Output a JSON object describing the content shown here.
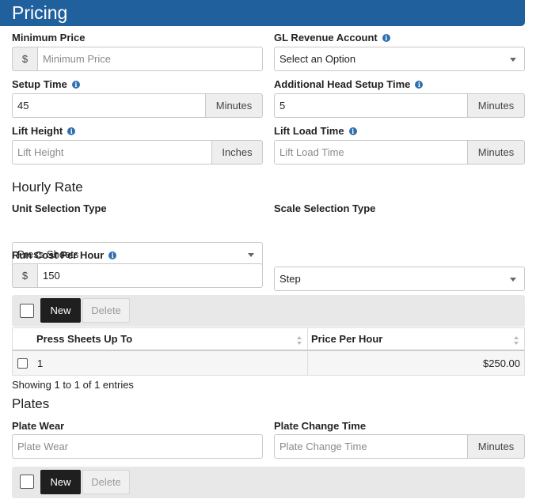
{
  "header": {
    "title": "Pricing"
  },
  "minimum_price": {
    "label": "Minimum Price",
    "prefix": "$",
    "placeholder": "Minimum Price",
    "value": ""
  },
  "gl_revenue_account": {
    "label": "GL Revenue Account",
    "selected": "Select an Option"
  },
  "setup_time": {
    "label": "Setup Time",
    "value": "45",
    "unit": "Minutes"
  },
  "additional_head_setup_time": {
    "label": "Additional Head Setup Time",
    "value": "5",
    "unit": "Minutes"
  },
  "lift_height": {
    "label": "Lift Height",
    "placeholder": "Lift Height",
    "unit": "Inches"
  },
  "lift_load_time": {
    "label": "Lift Load Time",
    "placeholder": "Lift Load Time",
    "unit": "Minutes"
  },
  "hourly_rate": {
    "title": "Hourly Rate",
    "unit_selection_type": {
      "label": "Unit Selection Type",
      "selected": "Press Sheets"
    },
    "scale_selection_type": {
      "label": "Scale Selection Type",
      "selected": "Step"
    },
    "run_cost_per_hour": {
      "label": "Run Cost Per Hour",
      "prefix": "$",
      "value": "150"
    },
    "toolbar": {
      "new_label": "New",
      "delete_label": "Delete"
    },
    "table": {
      "columns": [
        "Press Sheets Up To",
        "Price Per Hour"
      ],
      "rows": [
        {
          "up_to": "1",
          "price": "$250.00"
        }
      ]
    },
    "entries_info": "Showing 1 to 1 of 1 entries"
  },
  "plates": {
    "title": "Plates",
    "plate_wear": {
      "label": "Plate Wear",
      "placeholder": "Plate Wear"
    },
    "plate_change_time": {
      "label": "Plate Change Time",
      "placeholder": "Plate Change Time",
      "unit": "Minutes"
    },
    "toolbar": {
      "new_label": "New",
      "delete_label": "Delete"
    }
  },
  "info_icon_glyph": "i",
  "colors": {
    "header_bg": "#20619d",
    "info_icon": "#2f6fb0",
    "new_button": "#1f1f1f"
  }
}
